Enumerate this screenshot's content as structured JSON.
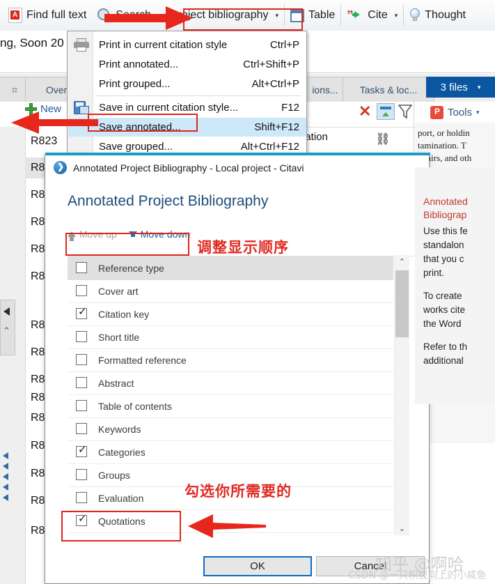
{
  "ribbon": {
    "items": [
      {
        "label": "Find full text",
        "icon": "pdf-icon",
        "caret": false
      },
      {
        "label": "Search",
        "icon": "magnifier-icon",
        "caret": false
      },
      {
        "label": "Project bibliography",
        "icon": "none",
        "caret": true
      },
      {
        "label": "Table",
        "icon": "table-icon",
        "caret": false
      },
      {
        "label": "Cite",
        "icon": "cite-icon",
        "caret": true
      },
      {
        "label": "Thought",
        "icon": "bulb-icon",
        "caret": false
      }
    ],
    "caret_glyph": "▾"
  },
  "document_fragment": "ng, Soon 20",
  "tabs": [
    {
      "id": "hash",
      "label": "⌗",
      "selected": false
    },
    {
      "id": "overview",
      "label": "Overview",
      "selected": false
    },
    {
      "id": "options",
      "label": "ions...",
      "selected": false
    },
    {
      "id": "tasks",
      "label": "Tasks & loc...",
      "selected": false
    }
  ],
  "files_button": {
    "label": "3 files",
    "caret": "▾"
  },
  "new_button": {
    "label": "New"
  },
  "tools_button": {
    "label": "Tools",
    "caret": "▾"
  },
  "row_icons": {
    "close": "✕",
    "collapse": "collapse-icon",
    "filter": "filter-icon"
  },
  "reference_fragment": "nation",
  "link_icon_glyph": "⛓",
  "result_list": [
    {
      "label": "R823",
      "selected": false
    },
    {
      "label": "R8",
      "selected": true
    },
    {
      "label": "R8",
      "selected": false
    },
    {
      "label": "R8",
      "selected": false
    },
    {
      "label": "R8",
      "selected": false
    },
    {
      "label": "R8",
      "selected": false
    },
    {
      "label": "R8",
      "selected": false
    },
    {
      "label": "R8",
      "selected": false
    },
    {
      "label": "R8",
      "selected": false
    },
    {
      "label": "R8",
      "selected": false
    },
    {
      "label": "R8",
      "selected": false
    },
    {
      "label": "R8",
      "selected": false
    },
    {
      "label": "R8",
      "selected": false
    },
    {
      "label": "R8",
      "selected": false
    },
    {
      "label": "R8",
      "selected": false
    }
  ],
  "right_preview_text": "port, or holdin\ntamination. T\nt hairs, and oth",
  "menu": {
    "items": [
      {
        "label": "Print in current citation style",
        "shortcut": "Ctrl+P",
        "icon": "printer-icon",
        "highlighted": false
      },
      {
        "label": "Print annotated...",
        "shortcut": "Ctrl+Shift+P",
        "icon": "none",
        "highlighted": false
      },
      {
        "label": "Print grouped...",
        "shortcut": "Alt+Ctrl+P",
        "icon": "none",
        "highlighted": false
      },
      {
        "label": "Save in current citation style...",
        "shortcut": "F12",
        "icon": "save-icon",
        "highlighted": false
      },
      {
        "label": "Save annotated...",
        "shortcut": "Shift+F12",
        "icon": "none",
        "highlighted": true
      },
      {
        "label": "Save grouped...",
        "shortcut": "Alt+Ctrl+F12",
        "icon": "none",
        "highlighted": false
      }
    ]
  },
  "dialog": {
    "window_title": "Annotated Project Bibliography - Local project - Citavi",
    "heading": "Annotated Project Bibliography",
    "move_up": "Move up",
    "move_down": "Move down",
    "fields": [
      {
        "label": "Reference type",
        "checked": false,
        "selected": true
      },
      {
        "label": "Cover art",
        "checked": false,
        "selected": false
      },
      {
        "label": "Citation key",
        "checked": true,
        "selected": false
      },
      {
        "label": "Short title",
        "checked": false,
        "selected": false
      },
      {
        "label": "Formatted reference",
        "checked": false,
        "selected": false
      },
      {
        "label": "Abstract",
        "checked": false,
        "selected": false
      },
      {
        "label": "Table of contents",
        "checked": false,
        "selected": false
      },
      {
        "label": "Keywords",
        "checked": false,
        "selected": false
      },
      {
        "label": "Categories",
        "checked": true,
        "selected": false
      },
      {
        "label": "Groups",
        "checked": false,
        "selected": false
      },
      {
        "label": "Evaluation",
        "checked": false,
        "selected": false
      },
      {
        "label": "Quotations",
        "checked": true,
        "selected": false
      }
    ],
    "ok": "OK",
    "cancel": "Cancel",
    "scroll_up_glyph": "⌃",
    "scroll_down_glyph": "⌄",
    "check_glyph": "✓"
  },
  "help_pane": {
    "title": "Annotated\nBibliograp",
    "paragraphs": [
      "Use this fe\nstandalon\nthat you c\nprint.",
      "To create\nworks cite\nthe Word",
      "Refer to th\nadditional"
    ]
  },
  "annotations": {
    "note_order": "调整显示顺序",
    "note_check": "勾选你所需要的",
    "accent_red": "#e0251b"
  },
  "watermarks": {
    "zhihu": "知乎 @啊哈",
    "csdn": "CSDN @一只积极向上的小咸鱼"
  }
}
